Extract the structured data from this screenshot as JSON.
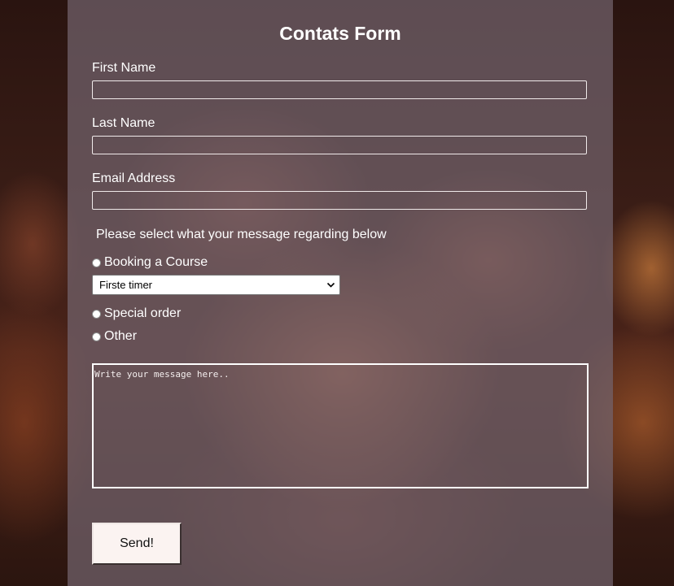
{
  "form": {
    "title": "Contats Form",
    "first_name": {
      "label": "First Name",
      "value": ""
    },
    "last_name": {
      "label": "Last Name",
      "value": ""
    },
    "email": {
      "label": "Email Address",
      "value": ""
    },
    "question": "Please select what your message regarding below",
    "options": [
      {
        "label": "Booking a Course",
        "selected": false
      },
      {
        "label": "Special order",
        "selected": false
      },
      {
        "label": "Other",
        "selected": false
      }
    ],
    "course_select": {
      "selected": "Firste timer"
    },
    "message": {
      "placeholder": "Write your message here..",
      "value": ""
    },
    "send_label": "Send!"
  },
  "colors": {
    "panel": "#73646e",
    "text": "#ffffff",
    "button_bg": "#fbf3f1"
  }
}
